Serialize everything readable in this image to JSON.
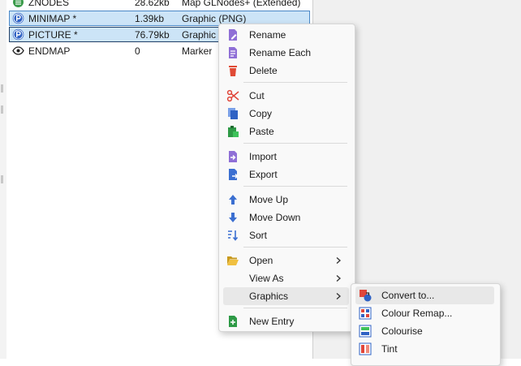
{
  "entries": [
    {
      "name": "ZNODES",
      "size": "28.62kb",
      "type": "Map GLNodes+ (Extended)",
      "icon": "znodes-icon",
      "selected": false
    },
    {
      "name": "MINIMAP *",
      "size": "1.39kb",
      "type": "Graphic (PNG)",
      "icon": "graphic-p-icon",
      "selected": true
    },
    {
      "name": "PICTURE *",
      "size": "76.79kb",
      "type": "Graphic (",
      "icon": "graphic-p-icon",
      "selected": true
    },
    {
      "name": "ENDMAP",
      "size": "0",
      "type": "Marker",
      "icon": "marker-eye-icon",
      "selected": false
    }
  ],
  "context_menu": {
    "rename": "Rename",
    "rename_each": "Rename Each",
    "delete": "Delete",
    "cut": "Cut",
    "copy": "Copy",
    "paste": "Paste",
    "import": "Import",
    "export": "Export",
    "move_up": "Move Up",
    "move_down": "Move Down",
    "sort": "Sort",
    "open": "Open",
    "view_as": "View As",
    "graphics": "Graphics",
    "new_entry": "New Entry"
  },
  "graphics_submenu": {
    "convert_to": "Convert to...",
    "colour_remap": "Colour Remap...",
    "colourise": "Colourise",
    "tint": "Tint"
  },
  "colors": {
    "selection_bg": "#cce4f7",
    "selection_border": "#4a88c7",
    "menu_bg": "#f9f9f9",
    "hover_bg": "#e8e8e8"
  }
}
